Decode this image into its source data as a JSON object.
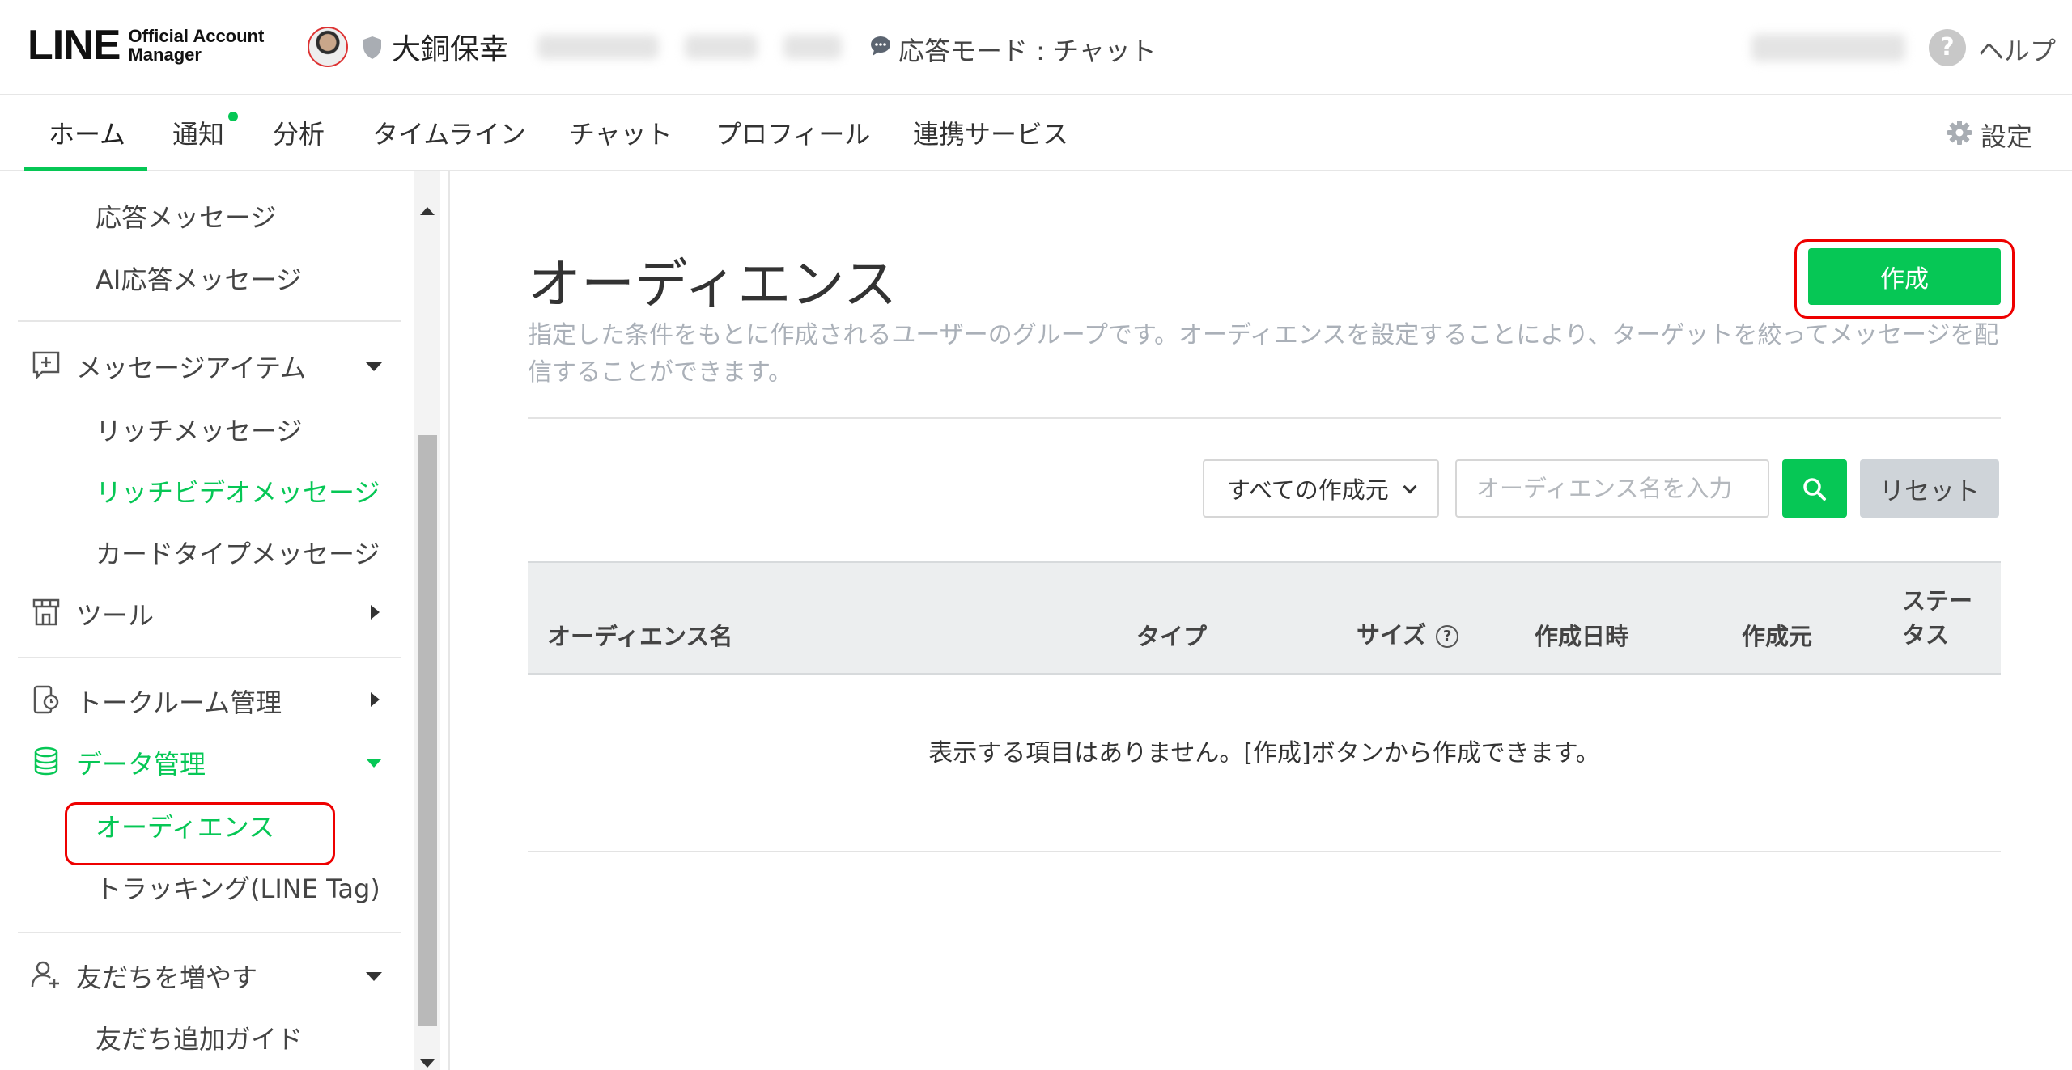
{
  "header": {
    "logo_main": "LINE",
    "logo_sub_1": "Official Account",
    "logo_sub_2": "Manager",
    "account_name": "大銅保幸",
    "mode_label": "応答モード : チャット",
    "help_label": "ヘルプ"
  },
  "nav": {
    "tabs": [
      {
        "label": "ホーム",
        "active": true
      },
      {
        "label": "通知"
      },
      {
        "label": "分析"
      },
      {
        "label": "タイムライン"
      },
      {
        "label": "チャット"
      },
      {
        "label": "プロフィール"
      },
      {
        "label": "連携サービス"
      }
    ],
    "settings_label": "設定"
  },
  "sidebar": {
    "items": [
      {
        "label": "応答メッセージ"
      },
      {
        "label": "AI応答メッセージ"
      },
      {
        "label": "メッセージアイテム"
      },
      {
        "label": "リッチメッセージ"
      },
      {
        "label": "リッチビデオメッセージ"
      },
      {
        "label": "カードタイプメッセージ"
      },
      {
        "label": "ツール"
      },
      {
        "label": "トークルーム管理"
      },
      {
        "label": "データ管理"
      },
      {
        "label": "オーディエンス"
      },
      {
        "label": "トラッキング(LINE Tag)"
      },
      {
        "label": "友だちを増やす"
      },
      {
        "label": "友だち追加ガイド"
      }
    ]
  },
  "main": {
    "title": "オーディエンス",
    "create_label": "作成",
    "description": "指定した条件をもとに作成されるユーザーのグループです。オーディエンスを設定することにより、ターゲットを絞ってメッセージを配信することができます。",
    "filter": {
      "selected": "すべての作成元",
      "search_placeholder": "オーディエンス名を入力",
      "reset_label": "リセット"
    },
    "table": {
      "columns": [
        "オーディエンス名",
        "タイプ",
        "サイズ",
        "作成日時",
        "作成元",
        "ステータス"
      ],
      "status_col_line1": "ステー",
      "status_col_line2": "タス",
      "size_help": "?",
      "empty_message": "表示する項目はありません。[作成]ボタンから作成できます。"
    }
  },
  "colors": {
    "accent": "#06c755",
    "highlight": "#e00000"
  }
}
